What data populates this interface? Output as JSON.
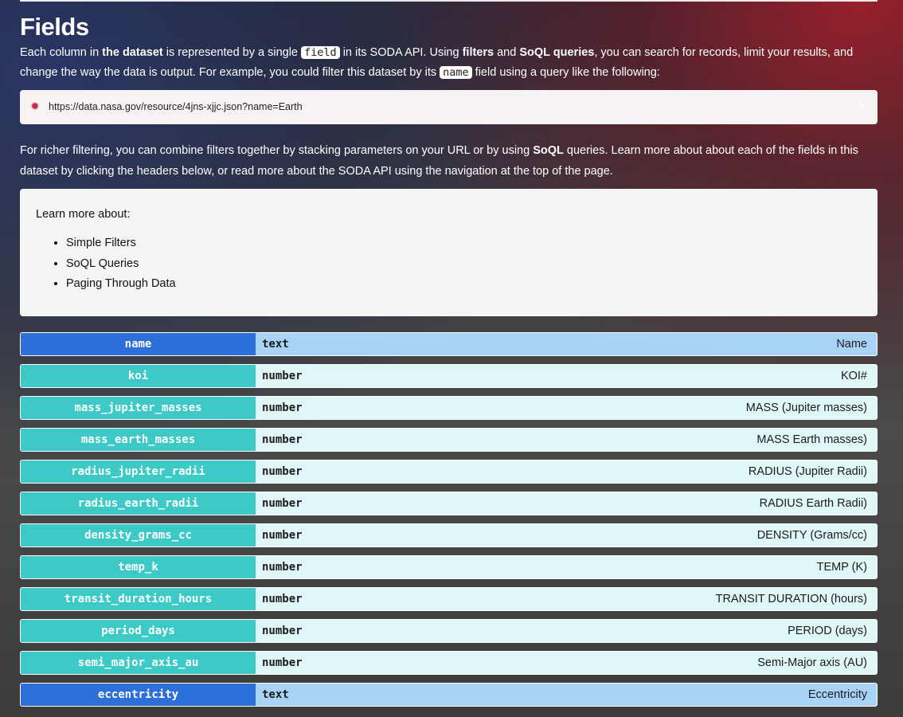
{
  "heading": "Fields",
  "intro": {
    "t1": "Each column in ",
    "b1": "the dataset",
    "t2": " is represented by a single ",
    "code1": "field",
    "t3": " in its SODA API. Using ",
    "b2": "filters",
    "t4": " and ",
    "b3": "SoQL queries",
    "t5": ", you can search for records, limit your results, and change the way the data is output. For example, you could filter this dataset by its ",
    "code2": "name",
    "t6": " field using a query like the following:"
  },
  "example_url": "https://data.nasa.gov/resource/4jns-xjjc.json?name=Earth",
  "richer": {
    "t1": "For richer filtering, you can combine filters together by stacking parameters on your URL or by using ",
    "b1": "SoQL",
    "t2": " queries. Learn more about about each of the fields in this dataset by clicking the headers below, or read more about the SODA API using the navigation at the top of the page."
  },
  "learn_more": {
    "title": "Learn more about:",
    "links": [
      "Simple Filters",
      "SoQL Queries",
      "Paging Through Data"
    ]
  },
  "fields": [
    {
      "name": "name",
      "type": "text",
      "desc": "Name"
    },
    {
      "name": "koi",
      "type": "number",
      "desc": "KOI#"
    },
    {
      "name": "mass_jupiter_masses",
      "type": "number",
      "desc": "MASS (Jupiter masses)"
    },
    {
      "name": "mass_earth_masses",
      "type": "number",
      "desc": "MASS Earth masses)"
    },
    {
      "name": "radius_jupiter_radii",
      "type": "number",
      "desc": "RADIUS (Jupiter Radii)"
    },
    {
      "name": "radius_earth_radii",
      "type": "number",
      "desc": "RADIUS Earth Radii)"
    },
    {
      "name": "density_grams_cc",
      "type": "number",
      "desc": "DENSITY (Grams/cc)"
    },
    {
      "name": "temp_k",
      "type": "number",
      "desc": "TEMP (K)"
    },
    {
      "name": "transit_duration_hours",
      "type": "number",
      "desc": "TRANSIT DURATION (hours)"
    },
    {
      "name": "period_days",
      "type": "number",
      "desc": "PERIOD (days)"
    },
    {
      "name": "semi_major_axis_au",
      "type": "number",
      "desc": "Semi-Major axis (AU)"
    },
    {
      "name": "eccentricity",
      "type": "text",
      "desc": "Eccentricity"
    }
  ],
  "colors": {
    "text_type_label": "#2d6fd9",
    "number_type_label": "#3ec9c9",
    "text_row_bg": "#a9d3f6",
    "number_row_bg": "#e0f7f7",
    "gear_icon": "#c72a4a"
  },
  "icons": {
    "url_box": "gear-icon",
    "copy": "pencil-icon"
  }
}
